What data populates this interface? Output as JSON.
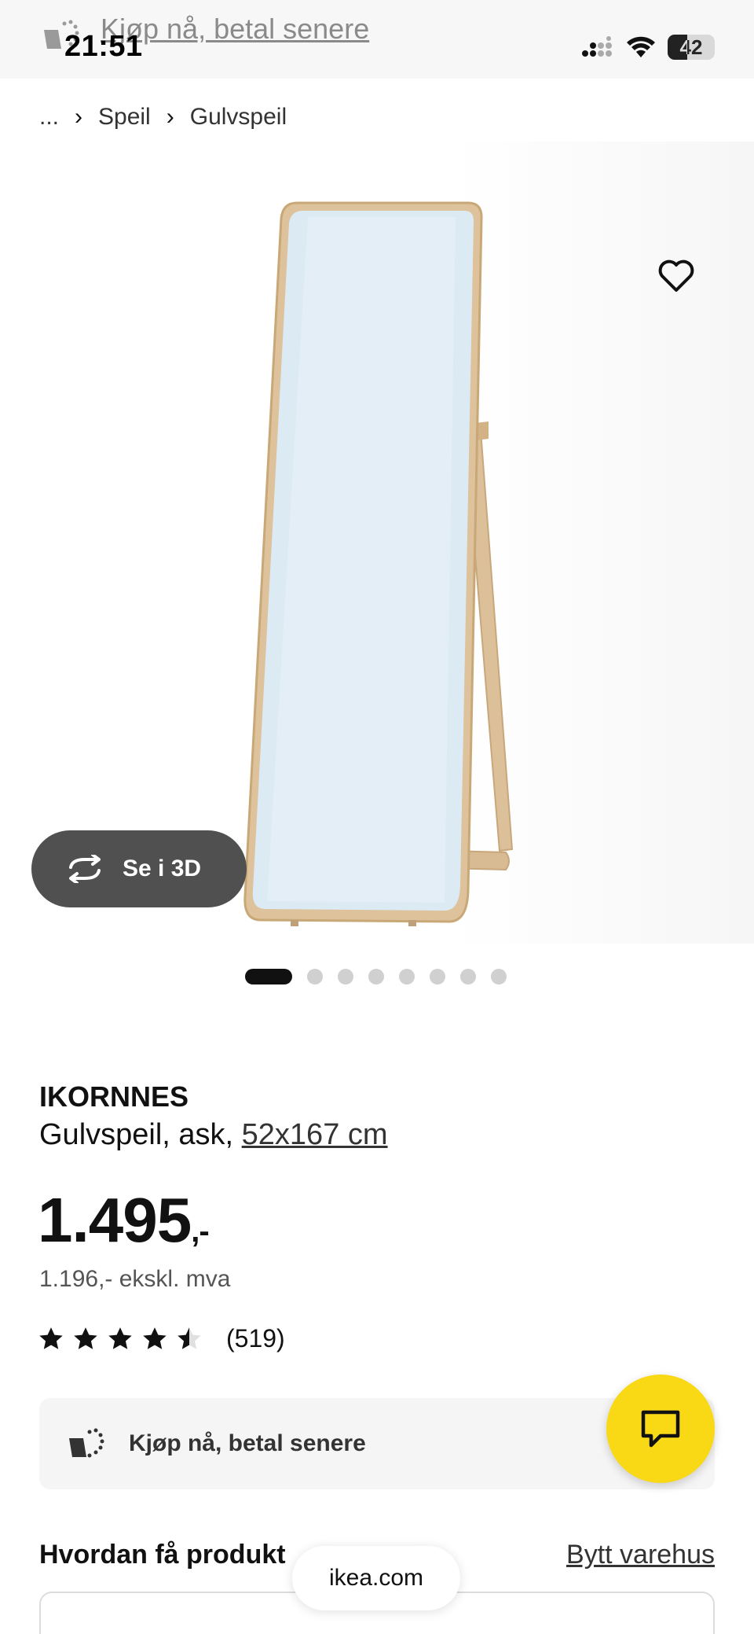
{
  "status_bar": {
    "time": "21:51",
    "battery": "42",
    "battery_level": 0.42,
    "signal_icon": "signal-icon",
    "wifi_icon": "wifi-icon"
  },
  "overlay_banner": {
    "text": "Kjøp nå, betal senere",
    "icon": "bag-sparkle-icon"
  },
  "breadcrumb": {
    "ellipsis": "...",
    "items": [
      "Speil",
      "Gulvspeil"
    ]
  },
  "product_image": {
    "favorite_icon": "heart-icon",
    "view_3d_label": "Se i 3D",
    "view_3d_icon": "rotate-icon",
    "slide_count": 8,
    "active_slide": 1
  },
  "product": {
    "name": "IKORNNES",
    "description": "Gulvspeil, ask,",
    "size": "52x167 cm",
    "price": "1.495",
    "price_suffix": ",-",
    "price_ex_vat": "1.196,- ekskl. mva",
    "rating_value": 4.5,
    "rating_max": 5,
    "review_count": "(519)"
  },
  "payment": {
    "label": "Kjøp nå, betal senere",
    "icon": "bag-sparkle-icon"
  },
  "chat": {
    "icon": "chat-icon",
    "accent": "#f9d815"
  },
  "delivery": {
    "title": "Hvordan få produkt",
    "change_store": "Bytt varehus"
  },
  "browser": {
    "url": "ikea.com"
  }
}
